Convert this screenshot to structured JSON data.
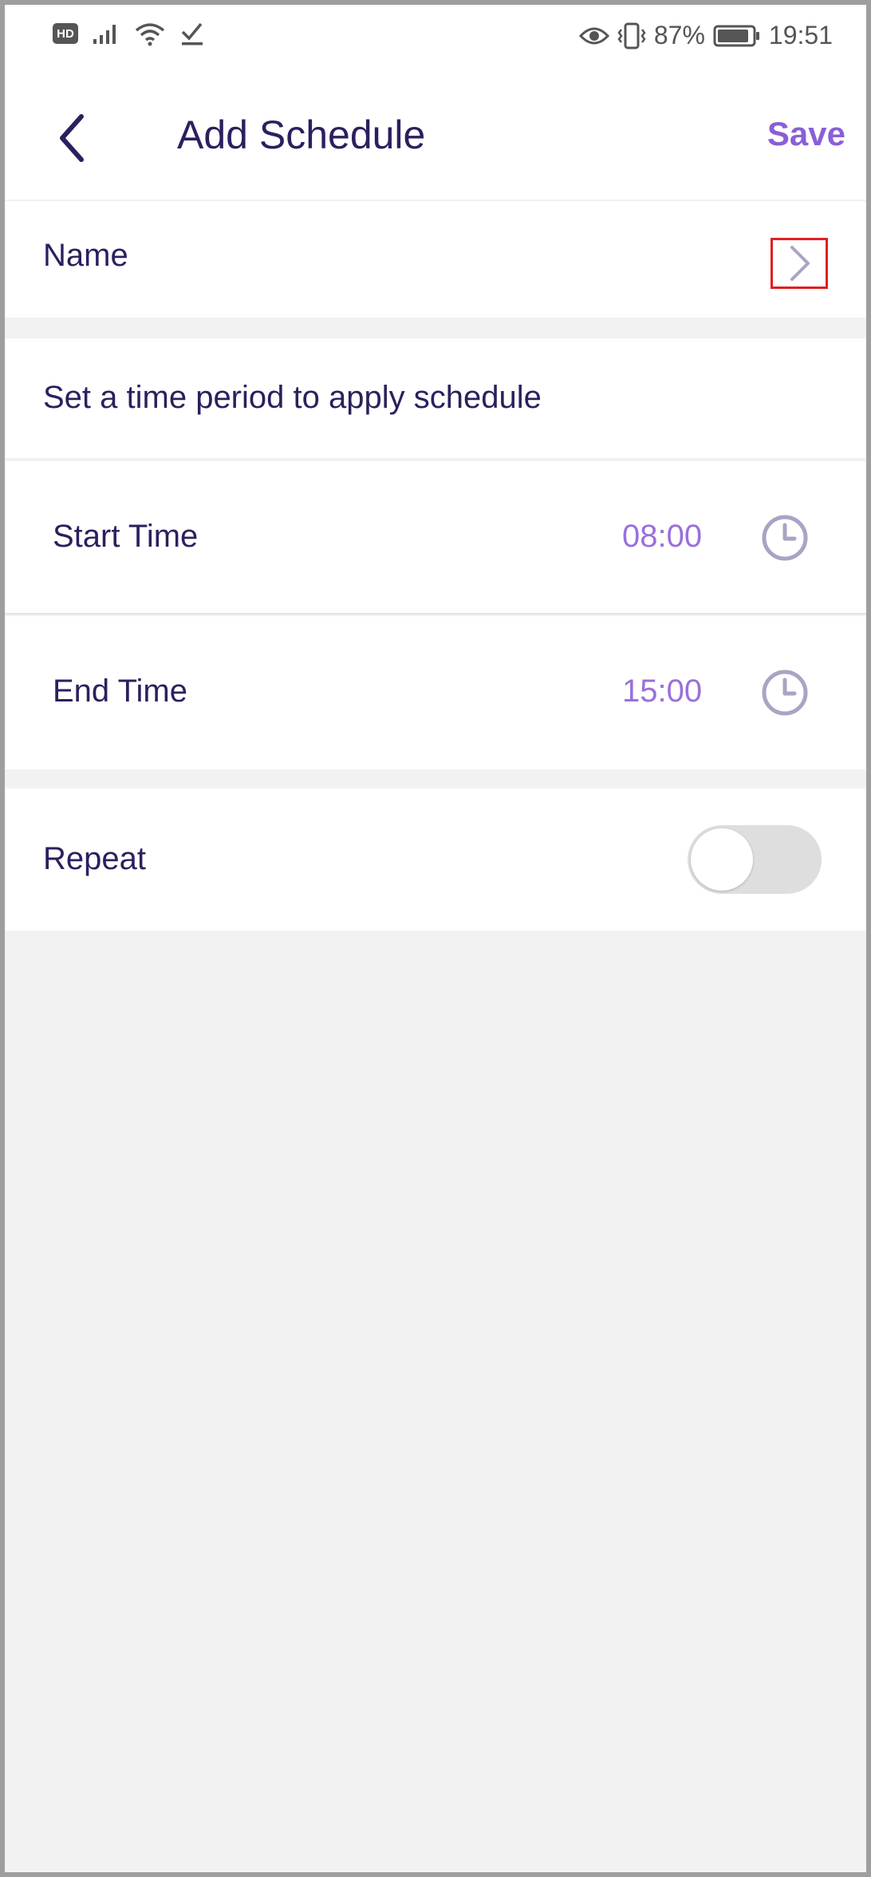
{
  "status_bar": {
    "hd_badge": "HD",
    "battery_percent": "87%",
    "time": "19:51",
    "icons": [
      "signal-icon",
      "wifi-icon",
      "check-icon",
      "eye-icon",
      "vibrate-icon",
      "battery-icon"
    ]
  },
  "header": {
    "title": "Add Schedule",
    "save_label": "Save",
    "back_icon": "chevron-left-icon"
  },
  "name_row": {
    "label": "Name",
    "icon": "chevron-right-icon"
  },
  "time_section": {
    "title": "Set a time period to apply schedule",
    "start": {
      "label": "Start Time",
      "value": "08:00",
      "icon": "clock-icon"
    },
    "end": {
      "label": "End Time",
      "value": "15:00",
      "icon": "clock-icon"
    }
  },
  "repeat": {
    "label": "Repeat",
    "enabled": false
  },
  "colors": {
    "primary_text": "#2d1f5e",
    "accent": "#8a5fd6",
    "time_value": "#9a70dc",
    "icon_gray": "#a9a4c3",
    "highlight_box": "#e0201f"
  }
}
